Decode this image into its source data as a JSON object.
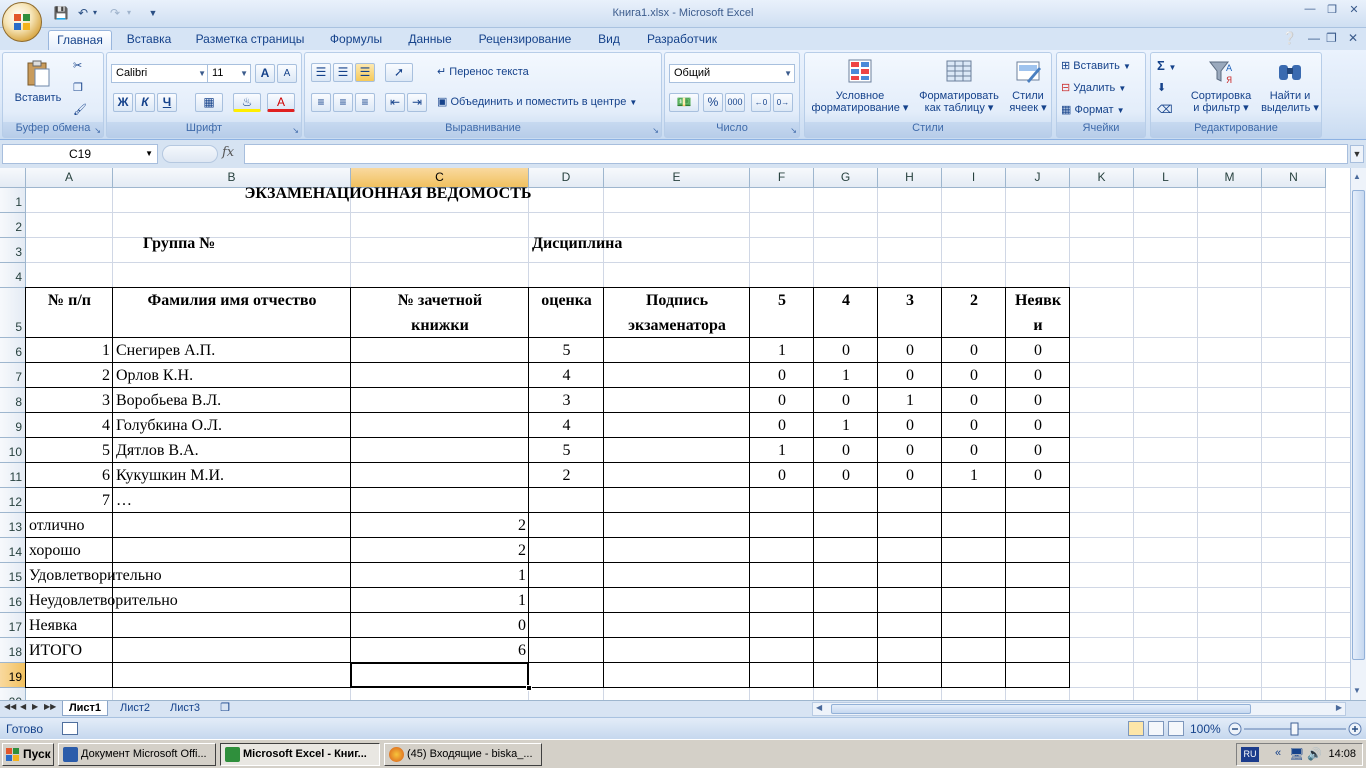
{
  "window": {
    "title": "Книга1.xlsx - Microsoft Excel"
  },
  "ribbon_tabs": [
    "Главная",
    "Вставка",
    "Разметка страницы",
    "Формулы",
    "Данные",
    "Рецензирование",
    "Вид",
    "Разработчик"
  ],
  "ribbon": {
    "clipboard": {
      "label": "Буфер обмена",
      "paste": "Вставить"
    },
    "font": {
      "label": "Шрифт",
      "name": "Calibri",
      "size": "11",
      "bold": "Ж",
      "italic": "К",
      "underline": "Ч",
      "grow": "A",
      "shrink": "A",
      "color_letter": "A"
    },
    "alignment": {
      "label": "Выравнивание",
      "wrap": "Перенос текста",
      "merge": "Объединить и поместить в центре"
    },
    "number": {
      "label": "Число",
      "format": "Общий",
      "percent": "%",
      "thousands": "000"
    },
    "styles": {
      "label": "Стили",
      "cond_format_1": "Условное",
      "cond_format_2": "форматирование",
      "as_table_1": "Форматировать",
      "as_table_2": "как таблицу",
      "cell_styles_1": "Стили",
      "cell_styles_2": "ячеек"
    },
    "cells": {
      "label": "Ячейки",
      "insert": "Вставить",
      "delete": "Удалить",
      "format": "Формат"
    },
    "editing": {
      "label": "Редактирование",
      "sort_1": "Сортировка",
      "sort_2": "и фильтр",
      "find_1": "Найти и",
      "find_2": "выделить",
      "sigma": "Σ"
    }
  },
  "formula_bar": {
    "name_box": "C19",
    "fx": "fx",
    "value": ""
  },
  "columns": [
    "A",
    "B",
    "C",
    "D",
    "E",
    "F",
    "G",
    "H",
    "I",
    "J",
    "K",
    "L",
    "M",
    "N"
  ],
  "rows": [
    "1",
    "2",
    "3",
    "4",
    "5",
    "6",
    "7",
    "8",
    "9",
    "10",
    "11",
    "12",
    "13",
    "14",
    "15",
    "16",
    "17",
    "18",
    "19",
    "20"
  ],
  "sheet": {
    "title": "ЭКЗАМЕНАЦИОННАЯ ВЕДОМОСТЬ",
    "group_label": "Группа №",
    "discipline_label": "Дисциплина",
    "headers": {
      "num": "№ п/п",
      "name": "Фамилия имя отчество",
      "book_1": "№ зачетной",
      "book_2": "книжки",
      "grade": "оценка",
      "sign_1": "Подпись",
      "sign_2": "экзаменатора",
      "g5": "5",
      "g4": "4",
      "g3": "3",
      "g2": "2",
      "absent_1": "Неявк",
      "absent_2": "и"
    },
    "students": [
      {
        "num": "1",
        "name": "Снегирев А.П.",
        "grade": "5",
        "g5": "1",
        "g4": "0",
        "g3": "0",
        "g2": "0",
        "absent": "0"
      },
      {
        "num": "2",
        "name": "Орлов К.Н.",
        "grade": "4",
        "g5": "0",
        "g4": "1",
        "g3": "0",
        "g2": "0",
        "absent": "0"
      },
      {
        "num": "3",
        "name": "Воробьева В.Л.",
        "grade": "3",
        "g5": "0",
        "g4": "0",
        "g3": "1",
        "g2": "0",
        "absent": "0"
      },
      {
        "num": "4",
        "name": "Голубкина О.Л.",
        "grade": "4",
        "g5": "0",
        "g4": "1",
        "g3": "0",
        "g2": "0",
        "absent": "0"
      },
      {
        "num": "5",
        "name": "Дятлов В.А.",
        "grade": "5",
        "g5": "1",
        "g4": "0",
        "g3": "0",
        "g2": "0",
        "absent": "0"
      },
      {
        "num": "6",
        "name": "Кукушкин М.И.",
        "grade": "2",
        "g5": "0",
        "g4": "0",
        "g3": "0",
        "g2": "1",
        "absent": "0"
      },
      {
        "num": "7",
        "name": "…",
        "grade": "",
        "g5": "",
        "g4": "",
        "g3": "",
        "g2": "",
        "absent": ""
      }
    ],
    "summary": [
      {
        "label": "отлично",
        "value": "2"
      },
      {
        "label": "хорошо",
        "value": "2"
      },
      {
        "label": "Удовлетворительно",
        "value": "1"
      },
      {
        "label": "Неудовлетворительно",
        "value": "1"
      },
      {
        "label": "Неявка",
        "value": "0"
      },
      {
        "label": "ИТОГО",
        "value": "6"
      }
    ]
  },
  "sheet_tabs": [
    "Лист1",
    "Лист2",
    "Лист3"
  ],
  "status": {
    "ready": "Готово",
    "zoom": "100%"
  },
  "taskbar": {
    "start": "Пуск",
    "tasks": [
      "Документ Microsoft Offi...",
      "Microsoft Excel - Книг...",
      "(45) Входящие - biska_..."
    ],
    "lang": "RU",
    "clock": "14:08"
  }
}
